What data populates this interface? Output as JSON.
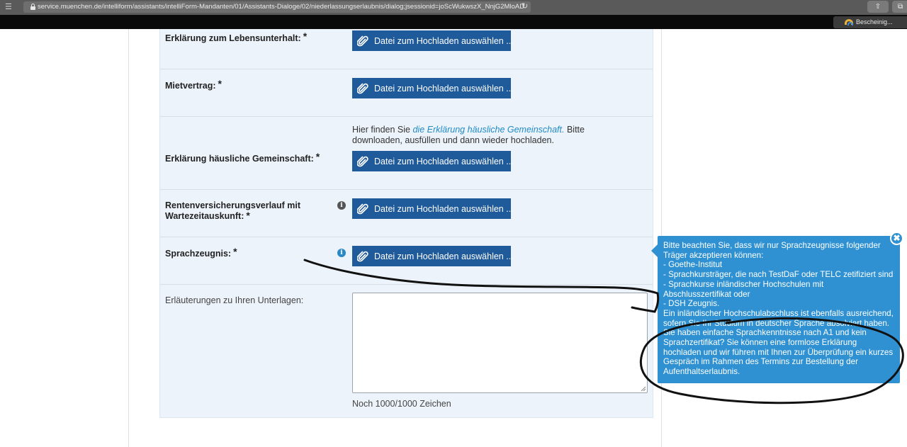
{
  "browser": {
    "url": "service.muenchen.de/intelliform/assistants/intelliForm-Mandanten/01/Assistants-Dialoge/02/niederlassungserlaubnis/dialog;jsessionid=joScWukwszX_NnjG2MloAD",
    "bookmark_label": "Bescheinig..."
  },
  "form": {
    "rows": [
      {
        "label": "Erklärung zum Lebensunterhalt:",
        "required": "*",
        "button": "Datei zum Hochladen auswählen ..."
      },
      {
        "label": "Mietvertrag:",
        "required": "*",
        "button": "Datei zum Hochladen auswählen ..."
      },
      {
        "label": "Erklärung häusliche Gemeinschaft:",
        "required": "*",
        "button": "Datei zum Hochladen auswählen ...",
        "hint_before": "Hier finden Sie ",
        "hint_link": "die Erklärung häusliche Gemeinschaft.",
        "hint_after": " Bitte downloaden, ausfüllen und dann wieder hochladen."
      },
      {
        "label": "Rentenversicherungsverlauf mit Wartezeitauskunft:",
        "required": "*",
        "button": "Datei zum Hochladen auswählen ..."
      },
      {
        "label": "Sprachzeugnis:",
        "required": "*",
        "button": "Datei zum Hochladen auswählen ..."
      }
    ],
    "notes_label": "Erläuterungen zu Ihren Unterlagen:",
    "notes_value": "",
    "notes_counter": "Noch 1000/1000 Zeichen"
  },
  "tooltip": {
    "lines": [
      "Bitte beachten Sie, dass wir nur Sprachzeugnisse folgender",
      "Träger akzeptieren können:",
      "- Goethe-Institut",
      "- Sprachkursträger, die nach TestDaF oder TELC zetifiziert sind",
      "- Sprachkurse inländischer Hochschulen mit",
      "Abschlusszertifikat oder",
      "- DSH Zeugnis.",
      "Ein inländischer Hochschulabschluss ist ebenfalls ausreichend,",
      "sofern Sie Ihr Studium in deutscher Sprache absolviert haben.",
      "Sie haben einfache Sprachkenntnisse nach A1 und kein",
      "Sprachzertifikat? Sie können eine formlose Erklärung",
      "hochladen und wir führen mit Ihnen zur Überprüfung ein kurzes",
      "Gespräch im Rahmen des Termins zur Bestellung der",
      "Aufenthaltserlaubnis."
    ],
    "close_glyph": "✖"
  },
  "icons": {
    "info_glyph": "i",
    "menu_glyph": "☰",
    "reload_glyph": "↻",
    "share_glyph": "⇧",
    "tabs_glyph": "⧉"
  },
  "colors": {
    "button_bg": "#1f5a9a",
    "tooltip_bg": "#2f91d2",
    "panel_bg": "#edf3fb",
    "link": "#1f8bc8"
  }
}
